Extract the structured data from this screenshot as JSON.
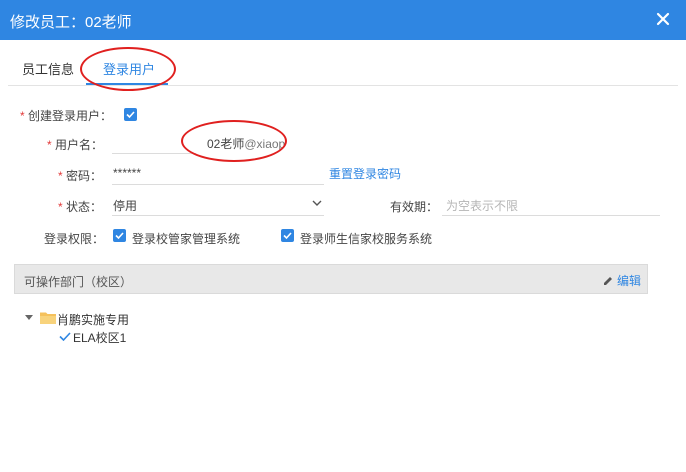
{
  "dialog": {
    "title": "修改员工：02老师"
  },
  "tabs": [
    {
      "label": "员工信息"
    },
    {
      "label": "登录用户"
    }
  ],
  "form": {
    "create_login": {
      "label": "创建登录用户：",
      "checked": true
    },
    "username": {
      "label": "用户名：",
      "value": "02老师",
      "suffix": "@xiaop"
    },
    "password": {
      "label": "密码：",
      "value": "******",
      "reset_link": "重置登录密码"
    },
    "status": {
      "label": "状态：",
      "value": "停用"
    },
    "validity": {
      "label": "有效期：",
      "placeholder": "为空表示不限"
    },
    "permissions": {
      "label": "登录权限：",
      "options": [
        {
          "label": "登录校管家管理系统",
          "checked": true
        },
        {
          "label": "登录师生信家校服务系统",
          "checked": true
        }
      ]
    }
  },
  "departments": {
    "title": "可操作部门（校区）",
    "edit_label": "编辑",
    "tree": {
      "root": "肖鹏实施专用",
      "children": [
        "ELA校区1"
      ]
    }
  },
  "colors": {
    "accent": "#2f86e2",
    "required": "#e23a3a",
    "annotation": "#e0201f"
  }
}
